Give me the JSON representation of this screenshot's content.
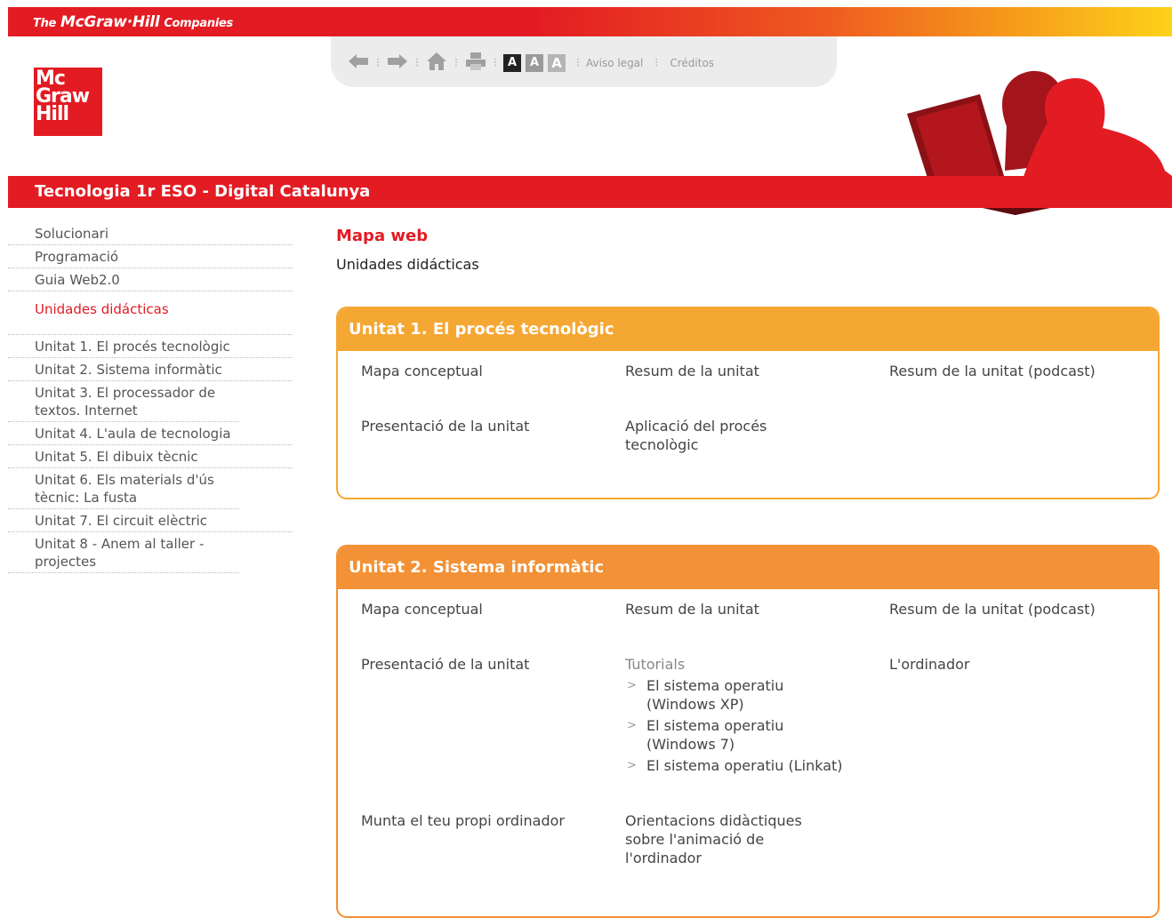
{
  "header": {
    "brand_the": "The",
    "brand_name": "McGraw·Hill",
    "brand_companies": "Companies",
    "logo_line1": "Mc",
    "logo_line2": "Graw",
    "logo_line3": "Hill"
  },
  "toolbar": {
    "aviso_legal": "Aviso legal",
    "creditos": "Créditos",
    "font_small": "A",
    "font_medium": "A",
    "font_large": "A"
  },
  "title_bar": {
    "title": "Tecnologia 1r ESO - Digital Catalunya"
  },
  "sidebar": {
    "top_items": [
      "Solucionari",
      "Programació",
      "Guia Web2.0"
    ],
    "section_label": "Unidades didácticas",
    "units": [
      "Unitat 1. El procés tecnològic",
      "Unitat 2. Sistema informàtic",
      "Unitat 3. El processador de textos. Internet",
      "Unitat 4. L'aula de tecnologia",
      "Unitat 5. El dibuix tècnic",
      "Unitat 6. Els materials d'ús tècnic: La fusta",
      "Unitat 7. El circuit elèctric",
      "Unitat 8 - Anem al taller - projectes"
    ]
  },
  "main": {
    "page_title": "Mapa web",
    "subtitle": "Unidades didácticas",
    "unit1": {
      "title": "Unitat 1. El procés tecnològic",
      "mapa": "Mapa conceptual",
      "resum": "Resum de la unitat",
      "podcast": "Resum de la unitat (podcast)",
      "presentacio": "Presentació de la unitat",
      "aplicacio": "Aplicació del procés tecnològic"
    },
    "unit2": {
      "title": "Unitat 2. Sistema informàtic",
      "mapa": "Mapa conceptual",
      "resum": "Resum de la unitat",
      "podcast": "Resum de la unitat (podcast)",
      "presentacio": "Presentació de la unitat",
      "tutorials": "Tutorials",
      "tut1": "El sistema operatiu (Windows XP)",
      "tut2": "El sistema operatiu (Windows 7)",
      "tut3": "El sistema operatiu (Linkat)",
      "ordinador": "L'ordinador",
      "munta": "Munta el teu propi ordinador",
      "orientacions": "Orientacions didàctiques sobre l'animació de l'ordinador"
    }
  },
  "colors": {
    "brand_red": "#e31b23",
    "unit1_orange": "#f5a733",
    "unit2_orange": "#f29135",
    "font_btn_dark": "#222222",
    "font_btn_mid": "#9a9a9a",
    "font_btn_light": "#b5b5b5"
  },
  "icons": [
    "back-arrow-icon",
    "forward-arrow-icon",
    "home-icon",
    "print-icon"
  ]
}
